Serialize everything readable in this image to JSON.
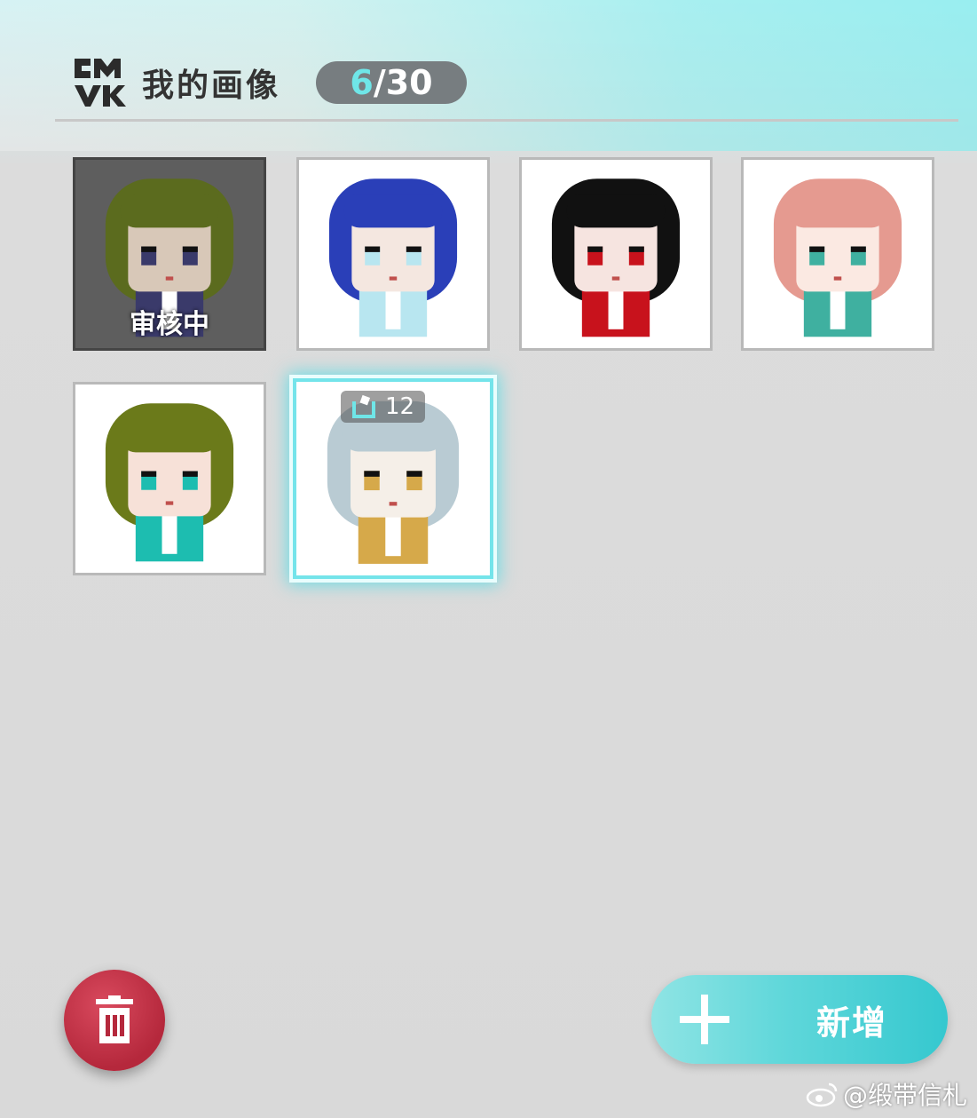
{
  "header": {
    "title": "我的画像",
    "count_current": "6",
    "count_separator": "/",
    "count_total": "30"
  },
  "avatars": [
    {
      "status": "审核中",
      "palette": {
        "hair": "#5b6b1e",
        "skin": "#d8c8b8",
        "accent": "#3a3a6a"
      }
    },
    {
      "palette": {
        "hair": "#2a3fb8",
        "skin": "#f4e7e0",
        "accent": "#b8e6f0"
      }
    },
    {
      "palette": {
        "hair": "#111111",
        "skin": "#f6e4e0",
        "accent": "#c8121c"
      }
    },
    {
      "palette": {
        "hair": "#e59a90",
        "skin": "#fbe9e2",
        "accent": "#3fb0a0"
      }
    },
    {
      "palette": {
        "hair": "#6b7a1a",
        "skin": "#f7e1d8",
        "accent": "#1dbdb0"
      }
    },
    {
      "badge_count": "12",
      "palette": {
        "hair": "#b9cbd3",
        "skin": "#f5efe8",
        "accent": "#d6a94a"
      }
    }
  ],
  "buttons": {
    "add_label": "新增",
    "delete_icon": "trash-icon",
    "add_icon": "plus-icon"
  },
  "watermark": "@缎带信札",
  "colors": {
    "accent": "#6fe6e8",
    "delete": "#b5283c",
    "add": "#35c8cf"
  }
}
